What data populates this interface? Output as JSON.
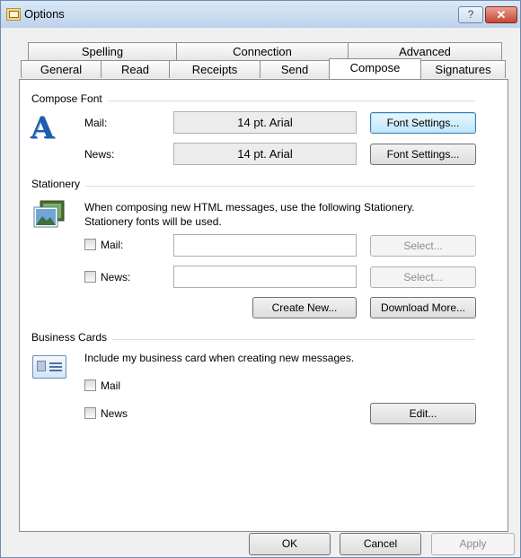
{
  "window": {
    "title": "Options",
    "help_label": "?",
    "close_label": "✕"
  },
  "tabs": {
    "row1": [
      {
        "label": "Spelling"
      },
      {
        "label": "Connection"
      },
      {
        "label": "Advanced"
      }
    ],
    "row2": [
      {
        "label": "General"
      },
      {
        "label": "Read"
      },
      {
        "label": "Receipts"
      },
      {
        "label": "Send"
      },
      {
        "label": "Compose"
      },
      {
        "label": "Signatures"
      }
    ],
    "active": "Compose"
  },
  "compose_font": {
    "group_label": "Compose Font",
    "mail_label": "Mail:",
    "mail_font": "14 pt. Arial",
    "mail_settings_button": "Font Settings...",
    "news_label": "News:",
    "news_font": "14 pt. Arial",
    "news_settings_button": "Font Settings..."
  },
  "stationery": {
    "group_label": "Stationery",
    "description": "When composing new HTML messages, use the following Stationery. Stationery fonts will be used.",
    "mail_checkbox": "Mail:",
    "mail_value": "",
    "mail_select_button": "Select...",
    "news_checkbox": "News:",
    "news_value": "",
    "news_select_button": "Select...",
    "create_new_button": "Create New...",
    "download_more_button": "Download More..."
  },
  "business_cards": {
    "group_label": "Business Cards",
    "description": "Include my business card when creating new messages.",
    "mail_checkbox": "Mail",
    "news_checkbox": "News",
    "edit_button": "Edit..."
  },
  "footer": {
    "ok": "OK",
    "cancel": "Cancel",
    "apply": "Apply"
  }
}
